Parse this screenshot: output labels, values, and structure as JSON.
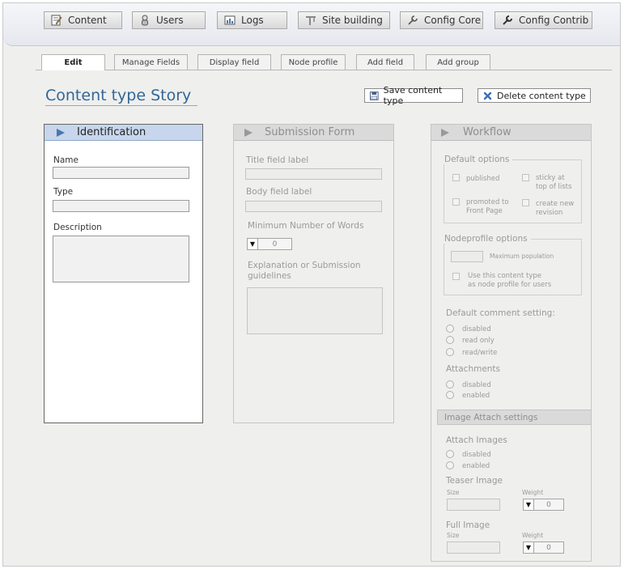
{
  "nav": {
    "items": [
      {
        "label": "Content",
        "icon": "edit-document-icon"
      },
      {
        "label": "Users",
        "icon": "user-icon"
      },
      {
        "label": "Logs",
        "icon": "chart-icon"
      },
      {
        "label": "Site building",
        "icon": "crane-icon"
      },
      {
        "label": "Config Core",
        "icon": "wrench-icon"
      },
      {
        "label": "Config Contrib",
        "icon": "wrench-icon"
      }
    ]
  },
  "tabs": {
    "items": [
      {
        "label": "Edit",
        "active": true
      },
      {
        "label": "Manage Fields"
      },
      {
        "label": "Display field"
      },
      {
        "label": "Node profile"
      },
      {
        "label": "Add field"
      },
      {
        "label": "Add group"
      }
    ]
  },
  "page": {
    "title": "Content type Story",
    "save_label": "Save content type",
    "delete_label": "Delete content type"
  },
  "identification": {
    "title": "Identification",
    "name_label": "Name",
    "type_label": "Type",
    "description_label": "Description",
    "name_value": "",
    "type_value": "",
    "description_value": ""
  },
  "submission": {
    "title": "Submission Form",
    "title_field_label": "Title field label",
    "body_field_label": "Body field label",
    "min_words_label": "Minimum Number of Words",
    "min_words_value": "0",
    "guidelines_label_1": "Explanation or Submission",
    "guidelines_label_2": "guidelines"
  },
  "workflow": {
    "title": "Workflow",
    "default_options_legend": "Default options",
    "published": "published",
    "sticky_1": "sticky at",
    "sticky_2": "top of lists",
    "promoted_1": "promoted to",
    "promoted_2": "Front Page",
    "revision_1": "create new",
    "revision_2": "revision",
    "nodeprofile_legend": "Nodeprofile options",
    "max_population": "Maximum population",
    "use_profile_1": "Use this content type",
    "use_profile_2": "as node profile for users",
    "comment_heading": "Default comment setting:",
    "comment_disabled": "disabled",
    "comment_read_only": "read only",
    "comment_read_write": "read/write",
    "attachments_heading": "Attachments",
    "attach_disabled": "disabled",
    "attach_enabled": "enabled",
    "image_attach_header": "Image Attach settings",
    "attach_images_heading": "Attach Images",
    "images_disabled": "disabled",
    "images_enabled": "enabled",
    "teaser_heading": "Teaser Image",
    "teaser_size_label": "Size",
    "teaser_weight_label": "Weight",
    "teaser_weight_value": "0",
    "full_heading": "Full Image",
    "full_size_label": "Size",
    "full_weight_label": "Weight",
    "full_weight_value": "0"
  },
  "colors": {
    "accent": "#336699",
    "active_panel_header": "#c7d6ec",
    "disabled_text": "#9a9a9a"
  }
}
